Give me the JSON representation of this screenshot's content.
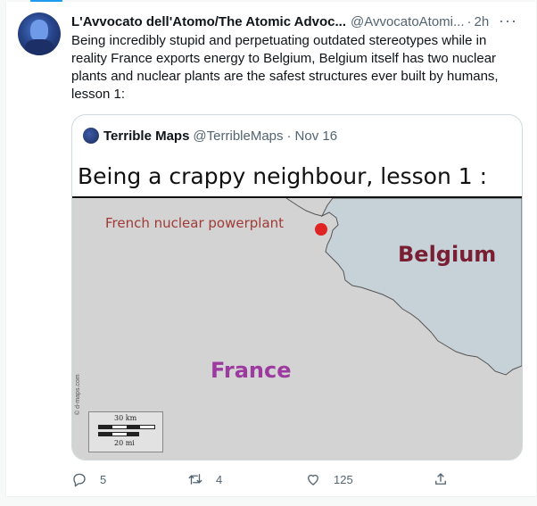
{
  "tweet": {
    "author_name": "L'Avvocato dell'Atomo/The Atomic Advoc...",
    "handle": "@AvvocatoAtomi...",
    "separator": "·",
    "time": "2h",
    "text": "Being incredibly stupid and perpetuating outdated stereotypes while in reality France exports energy to Belgium, Belgium itself has two nuclear plants and nuclear plants are the safest structures ever built by humans, lesson 1:",
    "more_icon": "more-horizontal-icon"
  },
  "quote": {
    "author_name": "Terrible Maps",
    "handle": "@TerribleMaps",
    "separator": "·",
    "date": "Nov 16",
    "map": {
      "title": "Being a crappy neighbour, lesson 1 :",
      "plant_label": "French nuclear powerplant",
      "belgium_label": "Belgium",
      "france_label": "France",
      "watermark": "© d-maps.com",
      "scale_km": "30 km",
      "scale_mi": "20 mi"
    }
  },
  "actions": {
    "reply_count": "5",
    "retweet_count": "4",
    "like_count": "125",
    "reply_icon": "reply-icon",
    "retweet_icon": "retweet-icon",
    "like_icon": "heart-icon",
    "share_icon": "share-icon"
  },
  "colors": {
    "accent": "#1d9bf0",
    "secondary_text": "#536471",
    "belgium_label": "#7a1f33",
    "france_label": "#9c3aa0",
    "plant_dot": "#e02424"
  }
}
